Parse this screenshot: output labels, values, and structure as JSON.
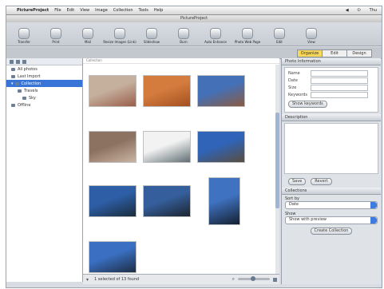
{
  "menubar": {
    "items": [
      "PictureProject",
      "File",
      "Edit",
      "View",
      "Image",
      "Collection",
      "Tools",
      "Help"
    ],
    "right": [
      "◀",
      "⏻",
      "Thu"
    ]
  },
  "window": {
    "title": "PictureProject"
  },
  "toolbar": {
    "buttons": [
      {
        "label": "Transfer",
        "icon": "transfer-icon"
      },
      {
        "label": "Print",
        "icon": "print-icon"
      },
      {
        "label": "Mail",
        "icon": "mail-icon"
      },
      {
        "label": "Resize Images (Link)",
        "icon": "resize-icon"
      },
      {
        "label": "Slideshow",
        "icon": "slideshow-icon"
      },
      {
        "label": "Burn",
        "icon": "burn-icon"
      },
      {
        "label": "Auto Enhance",
        "icon": "enhance-icon"
      },
      {
        "label": "Photo Web Page",
        "icon": "web-icon"
      },
      {
        "label": "Edit",
        "icon": "edit-icon"
      },
      {
        "label": "View",
        "icon": "view-icon"
      }
    ]
  },
  "viewmode": {
    "options": [
      "Organize",
      "Edit",
      "Design"
    ],
    "selected": 0
  },
  "sidebar": {
    "items": [
      {
        "label": "All photos",
        "level": 1
      },
      {
        "label": "Last Import",
        "level": 1
      },
      {
        "label": "Collection",
        "level": 0,
        "selected": true
      },
      {
        "label": "Travels",
        "level": 2
      },
      {
        "label": "Sky",
        "level": 3
      },
      {
        "label": "Offline",
        "level": 1
      }
    ]
  },
  "main": {
    "header": "Collection",
    "thumbnails": [
      {
        "name": "thumb-building-pink",
        "c1": "#c5b09e",
        "c2": "#9a5e4a"
      },
      {
        "name": "thumb-orange-rock",
        "c1": "#d47c3e",
        "c2": "#a44f20"
      },
      {
        "name": "thumb-tower-blue",
        "c1": "#4470b8",
        "c2": "#8a5b40"
      },
      {
        "name": "thumb-cliff-sea",
        "c1": "#8c7261",
        "c2": "#cbb4a3"
      },
      {
        "name": "thumb-clouds-sea",
        "c1": "#f2f2f2",
        "c2": "#5f6e73"
      },
      {
        "name": "thumb-ruins-blue",
        "c1": "#2f64b8",
        "c2": "#5a4d3f"
      },
      {
        "name": "thumb-palms-1",
        "c1": "#2d5ea6",
        "c2": "#1a2c3c"
      },
      {
        "name": "thumb-palms-2",
        "c1": "#355f9c",
        "c2": "#1d2430"
      },
      {
        "name": "thumb-palm-tall",
        "c1": "#3f72c0",
        "c2": "#152030"
      },
      {
        "name": "thumb-palm-sky",
        "c1": "#3a6fc1",
        "c2": "#1d2d45"
      }
    ],
    "status": "1 selected of 13 found"
  },
  "inspector": {
    "properties_title": "Photo Information",
    "fields": [
      "Name",
      "Date",
      "Size",
      "Keywords"
    ],
    "field_button": "Show keywords",
    "description_title": "Description",
    "btn_save": "Save",
    "btn_revert": "Revert",
    "details_title": "Collections",
    "sort_label": "Sort by",
    "sort_value": "Date",
    "view_label": "Show",
    "view_value": "Show with preview",
    "extra_button": "Create Collection"
  }
}
